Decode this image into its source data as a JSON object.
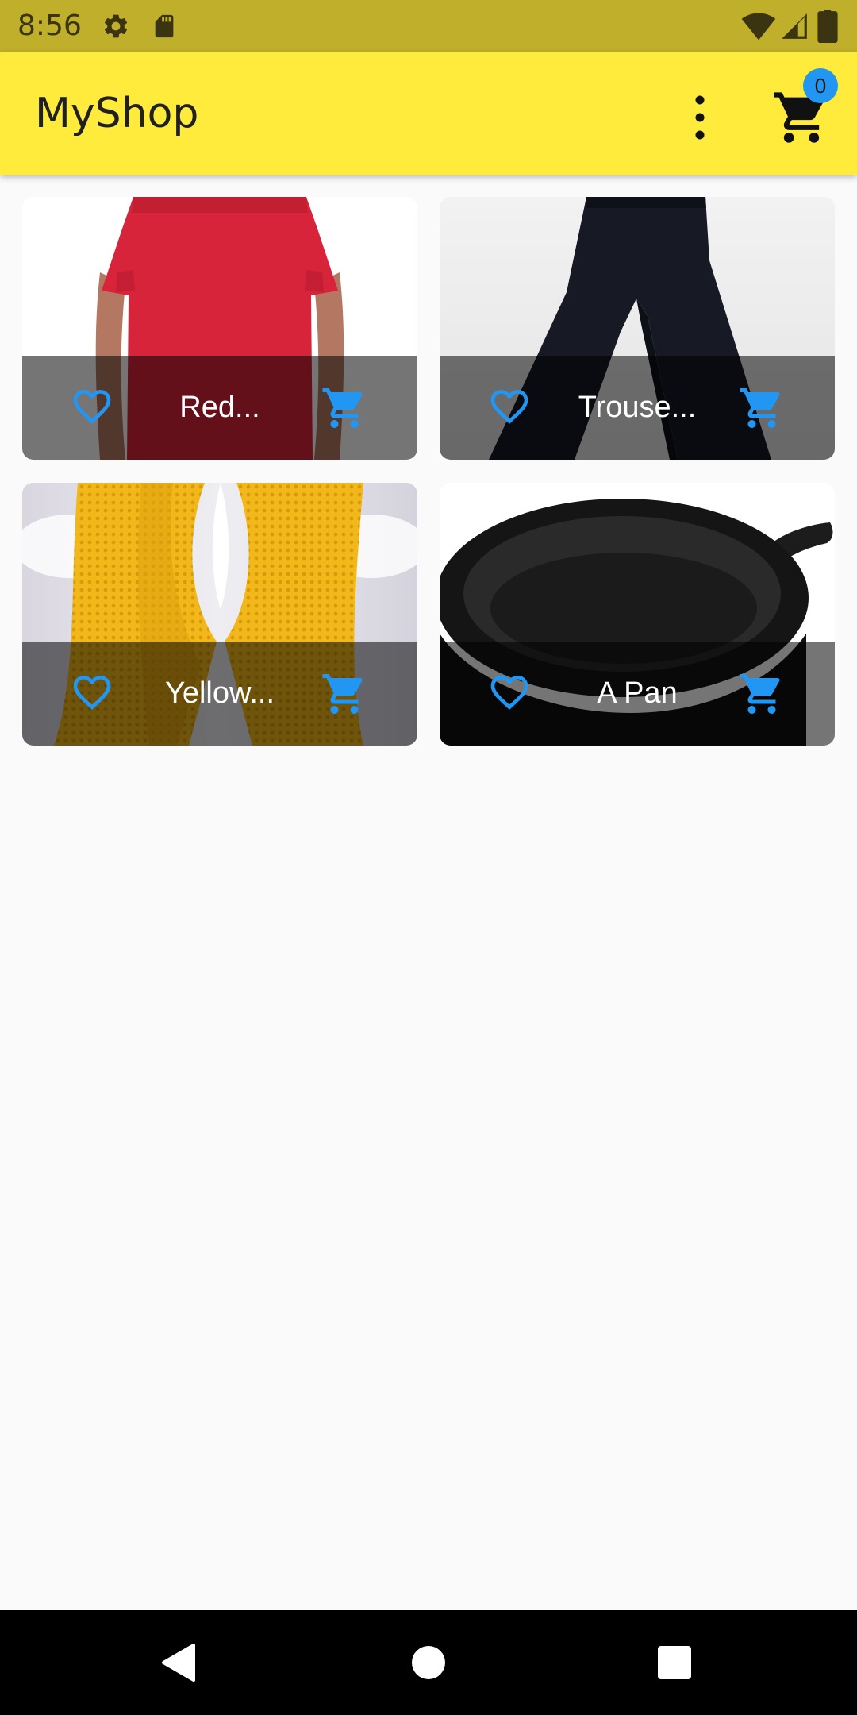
{
  "status_bar": {
    "time": "8:56",
    "icons": [
      "settings-icon",
      "sd-card-icon",
      "wifi-icon",
      "signal-icon",
      "battery-icon"
    ]
  },
  "app_bar": {
    "title": "MyShop",
    "menu_icon": "more-vert-icon",
    "cart_icon": "shopping-cart-icon",
    "cart_count": "0"
  },
  "products": [
    {
      "title": "Red...",
      "image": "red-tshirt",
      "favorite": false
    },
    {
      "title": "Trouse...",
      "image": "black-trousers",
      "favorite": false
    },
    {
      "title": "Yellow...",
      "image": "yellow-scarf",
      "favorite": false
    },
    {
      "title": "A Pan",
      "image": "cast-iron-pan",
      "favorite": false
    }
  ],
  "colors": {
    "status_bar": "#c0af2b",
    "app_bar": "#ffeb3b",
    "accent": "#2196f3",
    "background": "#fafafa"
  },
  "nav_bar": {
    "icons": [
      "back-icon",
      "home-icon",
      "recents-icon"
    ]
  }
}
